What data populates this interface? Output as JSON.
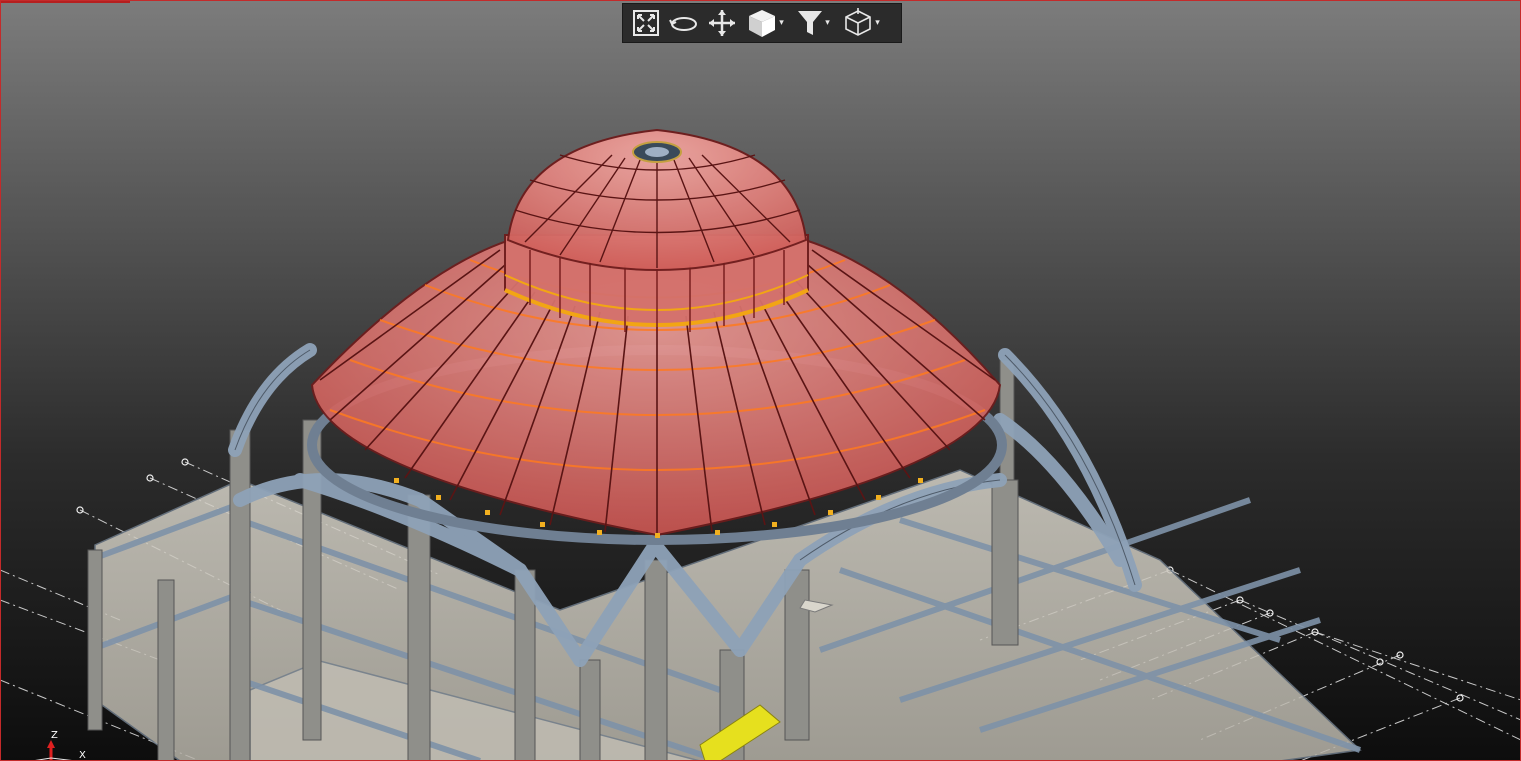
{
  "toolbar": {
    "buttons": [
      {
        "icon": "zoom-extents-icon",
        "has_dropdown": false
      },
      {
        "icon": "orbit-icon",
        "has_dropdown": false
      },
      {
        "icon": "pan-icon",
        "has_dropdown": false
      },
      {
        "icon": "view-cube-icon",
        "has_dropdown": true
      },
      {
        "icon": "filter-icon",
        "has_dropdown": true
      },
      {
        "icon": "section-box-icon",
        "has_dropdown": true
      }
    ]
  },
  "axes": {
    "z_label": "Z",
    "x_label": "X"
  },
  "colors": {
    "frame_border": "#c42a2a",
    "dome_glass": "#d96a6a",
    "dome_ribs": "#ff7a1f",
    "steel_members": "#8a9bb0",
    "concrete": "#9a9a94",
    "slab": "#c9c5bc",
    "highlight_object": "#e6e01e"
  }
}
